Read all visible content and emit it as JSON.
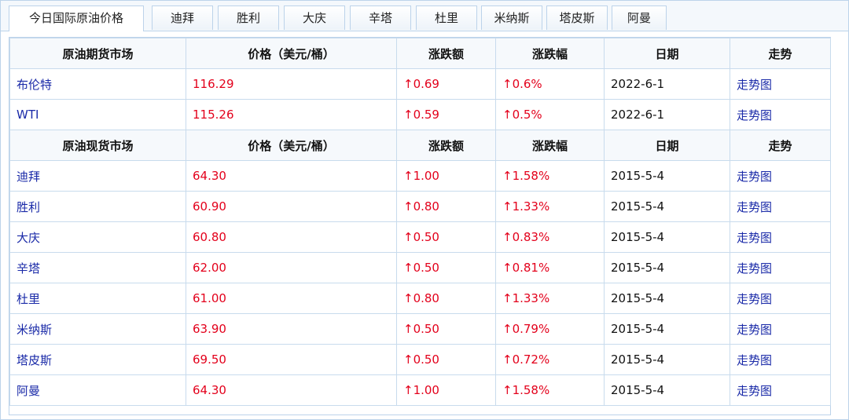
{
  "tabs": [
    {
      "label": "今日国际原油价格",
      "active": true
    },
    {
      "label": "迪拜"
    },
    {
      "label": "胜利"
    },
    {
      "label": "大庆"
    },
    {
      "label": "辛塔"
    },
    {
      "label": "杜里"
    },
    {
      "label": "米纳斯"
    },
    {
      "label": "塔皮斯"
    },
    {
      "label": "阿曼"
    }
  ],
  "futures": {
    "headers": [
      "原油期货市场",
      "价格（美元/桶）",
      "涨跌额",
      "涨跌幅",
      "日期",
      "走势"
    ],
    "rows": [
      {
        "market": "布伦特",
        "price": "116.29",
        "change": "↑0.69",
        "pct": "↑0.6%",
        "date": "2022-6-1",
        "trend": "走势图"
      },
      {
        "market": "WTI",
        "price": "115.26",
        "change": "↑0.59",
        "pct": "↑0.5%",
        "date": "2022-6-1",
        "trend": "走势图"
      }
    ]
  },
  "spot": {
    "headers": [
      "原油现货市场",
      "价格（美元/桶）",
      "涨跌额",
      "涨跌幅",
      "日期",
      "走势"
    ],
    "rows": [
      {
        "market": "迪拜",
        "price": "64.30",
        "change": "↑1.00",
        "pct": "↑1.58%",
        "date": "2015-5-4",
        "trend": "走势图"
      },
      {
        "market": "胜利",
        "price": "60.90",
        "change": "↑0.80",
        "pct": "↑1.33%",
        "date": "2015-5-4",
        "trend": "走势图"
      },
      {
        "market": "大庆",
        "price": "60.80",
        "change": "↑0.50",
        "pct": "↑0.83%",
        "date": "2015-5-4",
        "trend": "走势图"
      },
      {
        "market": "辛塔",
        "price": "62.00",
        "change": "↑0.50",
        "pct": "↑0.81%",
        "date": "2015-5-4",
        "trend": "走势图"
      },
      {
        "market": "杜里",
        "price": "61.00",
        "change": "↑0.80",
        "pct": "↑1.33%",
        "date": "2015-5-4",
        "trend": "走势图"
      },
      {
        "market": "米纳斯",
        "price": "63.90",
        "change": "↑0.50",
        "pct": "↑0.79%",
        "date": "2015-5-4",
        "trend": "走势图"
      },
      {
        "market": "塔皮斯",
        "price": "69.50",
        "change": "↑0.50",
        "pct": "↑0.72%",
        "date": "2015-5-4",
        "trend": "走势图"
      },
      {
        "market": "阿曼",
        "price": "64.30",
        "change": "↑1.00",
        "pct": "↑1.58%",
        "date": "2015-5-4",
        "trend": "走势图"
      }
    ]
  },
  "colors": {
    "accent_link": "#1a2aa8",
    "up_red": "#e3001b",
    "border": "#bcd3ea"
  }
}
